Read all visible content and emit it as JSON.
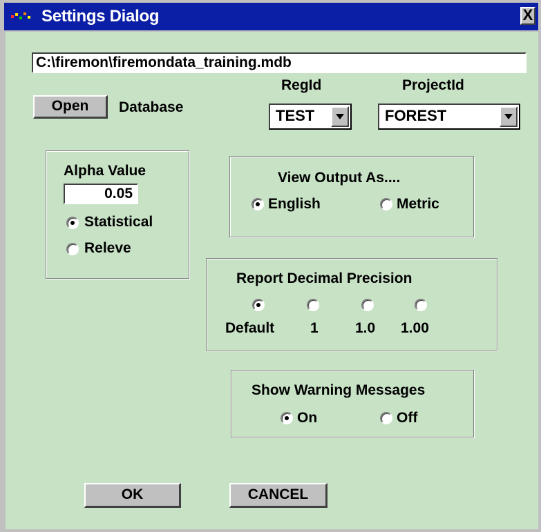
{
  "window": {
    "title": "Settings Dialog",
    "close_glyph": "X"
  },
  "database": {
    "path": "C:\\firemon\\firemondata_training.mdb",
    "open_label": "Open",
    "label": "Database"
  },
  "reg": {
    "label": "RegId",
    "value": "TEST"
  },
  "project": {
    "label": "ProjectId",
    "value": "FOREST"
  },
  "alpha": {
    "title": "Alpha Value",
    "value": "0.05",
    "options": [
      "Statistical",
      "Releve"
    ],
    "selected": "Statistical"
  },
  "view_output": {
    "title": "View Output As....",
    "options": [
      "English",
      "Metric"
    ],
    "selected": "English"
  },
  "precision": {
    "title": "Report Decimal Precision",
    "options": [
      "Default",
      "1",
      "1.0",
      "1.00"
    ],
    "selected": "Default"
  },
  "warnings": {
    "title": "Show Warning Messages",
    "options": [
      "On",
      "Off"
    ],
    "selected": "On"
  },
  "buttons": {
    "ok": "OK",
    "cancel": "CANCEL"
  },
  "colors": {
    "titlebar": "#0a1fa6",
    "client_bg": "#c8e2c6",
    "button_face": "#c0c0c0"
  }
}
